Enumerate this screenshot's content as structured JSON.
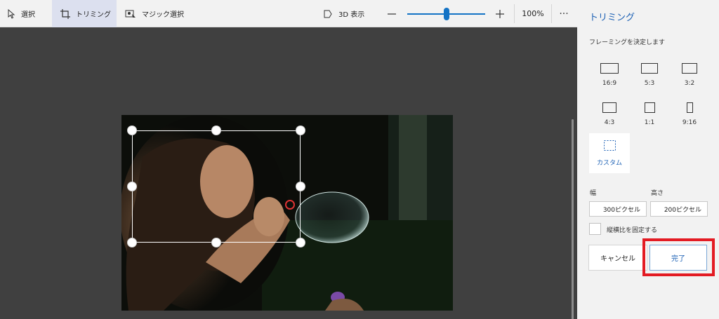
{
  "toolbar": {
    "select_label": "選択",
    "crop_label": "トリミング",
    "magic_select_label": "マジック選択",
    "view3d_label": "3D 表示",
    "zoom_minus": "−",
    "zoom_plus": "+",
    "zoom_level": "100%",
    "zoom_fraction": 0.5,
    "more_label": "···"
  },
  "panel": {
    "title": "トリミング",
    "subtitle": "フレーミングを決定します",
    "ratios": [
      {
        "label": "16:9"
      },
      {
        "label": "5:3"
      },
      {
        "label": "3:2"
      },
      {
        "label": "4:3"
      },
      {
        "label": "1:1"
      },
      {
        "label": "9:16"
      }
    ],
    "custom_label": "カスタム",
    "width_label": "幅",
    "height_label": "高さ",
    "width_value": "300ピクセル",
    "height_value": "200ピクセル",
    "lock_aspect_label": "縦横比を固定する",
    "lock_aspect_checked": false,
    "cancel_label": "キャンセル",
    "done_label": "完了"
  },
  "colors": {
    "accent": "#1473c5",
    "highlight": "#e31b23",
    "canvas_bg": "#404040",
    "panel_bg": "#f2f2f2"
  }
}
